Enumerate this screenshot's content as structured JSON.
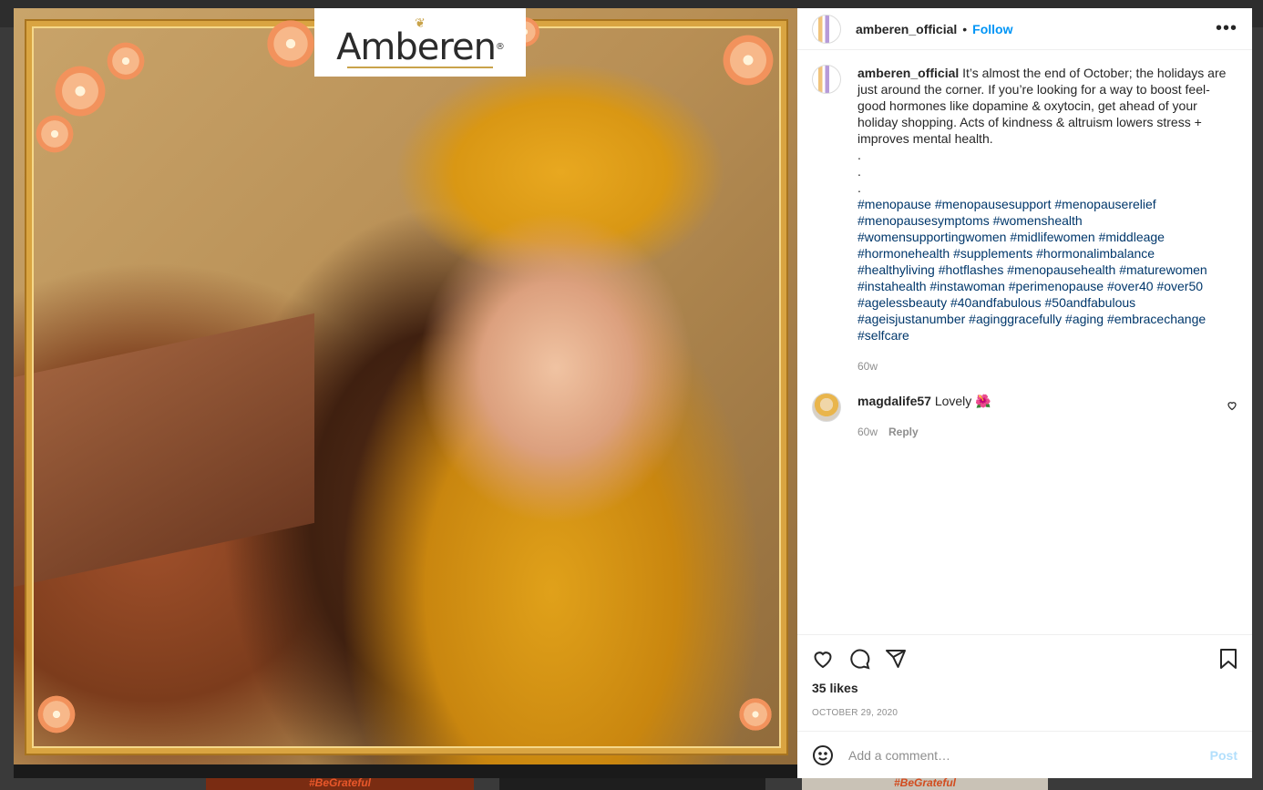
{
  "backdrop": {
    "tile_texts": [
      "#BeGrateful",
      "",
      "#BeGrateful"
    ]
  },
  "media": {
    "logo_text": "Amberen",
    "logo_mark": "®"
  },
  "header": {
    "username": "amberen_official",
    "separator": "•",
    "follow_label": "Follow",
    "more_icon": "more-horizontal-icon"
  },
  "caption": {
    "username": "amberen_official",
    "text": "It’s almost the end of October; the holidays are just around the corner. If you’re looking for a way to boost feel-good hormones like dopamine & oxytocin, get ahead of your holiday shopping. Acts of kindness & altruism lowers stress + improves mental health.\n.\n.\n.",
    "hashtags": "#menopause #menopausesupport #menopauserelief #menopausesymptoms #womenshealth #womensupportingwomen #midlifewomen #middleage #hormonehealth #supplements #hormonalimbalance #healthyliving #hotflashes #menopausehealth #maturewomen #instahealth #instawoman #perimenopause #over40 #over50 #agelessbeauty #40andfabulous #50andfabulous #ageisjustanumber #aginggracefully #aging #embracechange #selfcare",
    "age": "60w"
  },
  "comments": [
    {
      "username": "magdalife57",
      "text": "Lovely 🌺",
      "age": "60w",
      "reply_label": "Reply"
    }
  ],
  "actions": {
    "likes": "35 likes",
    "date": "OCTOBER 29, 2020"
  },
  "add_comment": {
    "placeholder": "Add a comment…",
    "post_label": "Post"
  },
  "colors": {
    "link_blue": "#0095f6",
    "hashtag_blue": "#00376b",
    "post_disabled": "#b2dffc",
    "frame_gold": "#d9a441"
  }
}
